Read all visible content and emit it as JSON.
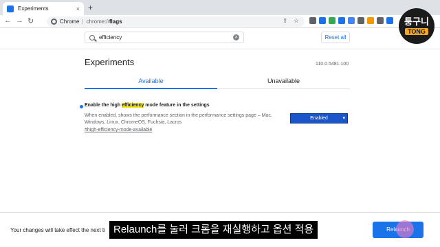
{
  "browser": {
    "tab_title": "Experiments",
    "tab_close": "×",
    "new_tab": "+",
    "tab_menu": "⌄",
    "omnibox": {
      "origin": "Chrome",
      "separator": "|",
      "url_prefix": "chrome://",
      "url_bold": "flags"
    },
    "nav": {
      "back": "←",
      "forward": "→",
      "reload": "↻"
    },
    "omni_icons": {
      "share": "⇪",
      "star": "☆"
    }
  },
  "logo": {
    "top": "퉁구니",
    "bottom": "TONG"
  },
  "search": {
    "value": "efficiency",
    "clear": "×"
  },
  "reset_label": "Reset all",
  "page_title": "Experiments",
  "version": "110.0.5481.100",
  "tabs": {
    "available": "Available",
    "unavailable": "Unavailable"
  },
  "experiment": {
    "title_before": "Enable the high ",
    "title_highlight": "efficiency",
    "title_after": " mode feature in the settings",
    "description": "When enabled, shows the performance section in the performance settings page – Mac, Windows, Linux, ChromeOS, Fuchsia, Lacros",
    "link": "#high-efficiency-mode-available",
    "selected": "Enabled",
    "chevron": "▾"
  },
  "bottom": {
    "message": "Your changes will take effect the next ti",
    "relaunch": "Relaunch"
  },
  "subtitle": "Relaunch를 눌러 크롬을 재실행하고 옵션 적용",
  "colors": {
    "accent": "#1a73e8",
    "highlight": "#f7e600",
    "logo_badge": "#f5a623"
  },
  "extension_colors": [
    "#5f6368",
    "#1a73e8",
    "#34a853",
    "#1a73e8",
    "#4285f4",
    "#5f6368",
    "#f29900",
    "#5f6368",
    "#1a73e8"
  ]
}
